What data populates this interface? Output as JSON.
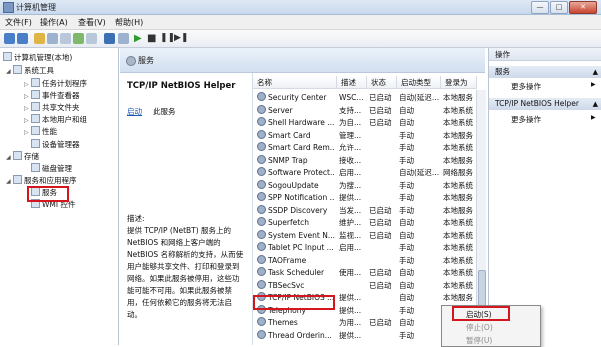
{
  "window": {
    "title": "计算机管理",
    "buttons": [
      "—",
      "□",
      "✕"
    ]
  },
  "menu": [
    "文件(F)",
    "操作(A)",
    "查看(V)",
    "帮助(H)"
  ],
  "tree": {
    "root": "计算机管理(本地)",
    "system_tools": "系统工具",
    "task_scheduler": "任务计划程序",
    "event_viewer": "事件查看器",
    "shared_folders": "共享文件夹",
    "local_users": "本地用户和组",
    "performance": "性能",
    "device_manager": "设备管理器",
    "storage": "存储",
    "disk_mgmt": "磁盘管理",
    "services_apps": "服务和应用程序",
    "services": "服务",
    "wmi": "WMI 控件"
  },
  "header": {
    "title": "服务"
  },
  "desc": {
    "service_name": "TCP/IP NetBIOS Helper",
    "start_link": "启动",
    "start_rest": "此服务",
    "desc_label": "描述:",
    "desc_text": "提供 TCP/IP (NetBT) 服务上的 NetBIOS 和网络上客户端的 NetBIOS 名称解析的支持，从而使用户能够共享文件、打印和登录到网络。如果此服务被停用，这些功能可能不可用。如果此服务被禁用，任何依赖它的服务将无法启动。"
  },
  "columns": [
    "名称",
    "描述",
    "状态",
    "启动类型",
    "登录为"
  ],
  "services": [
    {
      "name": "Security Center",
      "desc": "WSC...",
      "status": "已启动",
      "startup": "自动(延迟...",
      "logon": "本地服务"
    },
    {
      "name": "Server",
      "desc": "支持...",
      "status": "已启动",
      "startup": "自动",
      "logon": "本地系统"
    },
    {
      "name": "Shell Hardware ...",
      "desc": "为自...",
      "status": "已启动",
      "startup": "自动",
      "logon": "本地系统"
    },
    {
      "name": "Smart Card",
      "desc": "管理...",
      "status": "",
      "startup": "手动",
      "logon": "本地服务"
    },
    {
      "name": "Smart Card Rem...",
      "desc": "允许...",
      "status": "",
      "startup": "手动",
      "logon": "本地系统"
    },
    {
      "name": "SNMP Trap",
      "desc": "接收...",
      "status": "",
      "startup": "手动",
      "logon": "本地服务"
    },
    {
      "name": "Software Protect...",
      "desc": "启用...",
      "status": "",
      "startup": "自动(延迟...",
      "logon": "网络服务"
    },
    {
      "name": "SogouUpdate",
      "desc": "为搜...",
      "status": "",
      "startup": "手动",
      "logon": "本地系统"
    },
    {
      "name": "SPP Notification ...",
      "desc": "提供...",
      "status": "",
      "startup": "手动",
      "logon": "本地服务"
    },
    {
      "name": "SSDP Discovery",
      "desc": "当发...",
      "status": "已启动",
      "startup": "手动",
      "logon": "本地服务"
    },
    {
      "name": "Superfetch",
      "desc": "维护...",
      "status": "已启动",
      "startup": "自动",
      "logon": "本地系统"
    },
    {
      "name": "System Event N...",
      "desc": "监视...",
      "status": "已启动",
      "startup": "自动",
      "logon": "本地系统"
    },
    {
      "name": "Tablet PC Input ...",
      "desc": "启用...",
      "status": "",
      "startup": "手动",
      "logon": "本地系统"
    },
    {
      "name": "TAOFrame",
      "desc": "",
      "status": "",
      "startup": "手动",
      "logon": "本地系统"
    },
    {
      "name": "Task Scheduler",
      "desc": "使用...",
      "status": "已启动",
      "startup": "自动",
      "logon": "本地系统"
    },
    {
      "name": "TBSecSvc",
      "desc": "",
      "status": "已启动",
      "startup": "自动",
      "logon": "本地系统"
    },
    {
      "name": "TCP/IP NetBIOS ...",
      "desc": "提供...",
      "status": "",
      "startup": "自动",
      "logon": "本地服务"
    },
    {
      "name": "Telephony",
      "desc": "提供...",
      "status": "",
      "startup": "手动",
      "logon": ""
    },
    {
      "name": "Themes",
      "desc": "为用...",
      "status": "已启动",
      "startup": "自动",
      "logon": ""
    },
    {
      "name": "Thread Orderin...",
      "desc": "提供...",
      "status": "",
      "startup": "手动",
      "logon": ""
    }
  ],
  "actions": {
    "heading": "操作",
    "section1": "服务",
    "more1": "更多操作",
    "section2": "TCP/IP NetBIOS Helper",
    "more2": "更多操作"
  },
  "context_menu": {
    "start": "启动(S)",
    "stop": "停止(O)",
    "pause": "暂停(U)"
  }
}
